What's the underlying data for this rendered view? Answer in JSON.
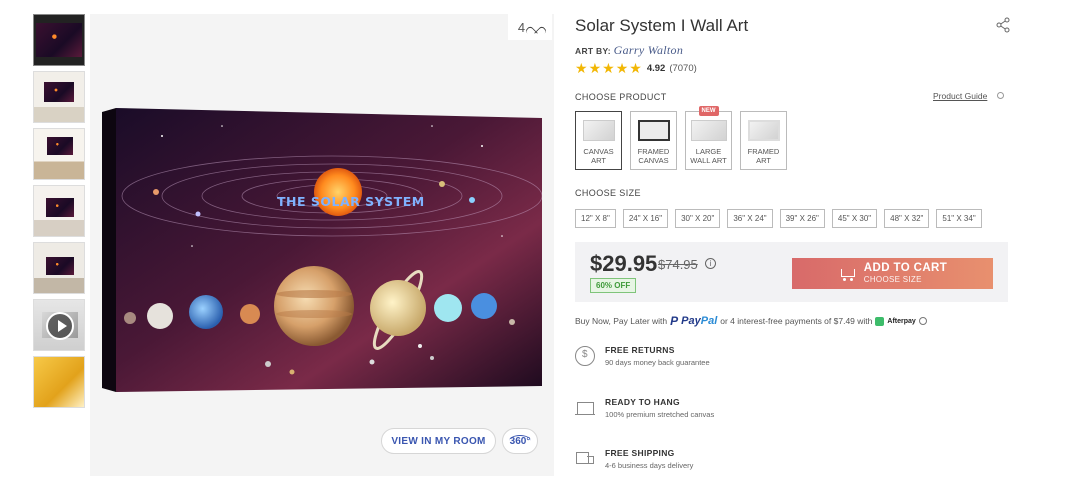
{
  "gallery": {
    "favorite_count": "4",
    "view_in_room_label": "VIEW IN MY ROOM",
    "view_360_label": "360°",
    "art_heading": "THE SOLAR SYSTEM"
  },
  "product": {
    "title": "Solar System I Wall Art",
    "art_by_label": "ART BY:",
    "artist": "Garry Walton",
    "rating": {
      "stars": 4.92,
      "score": "4.92",
      "count": "(7070)"
    },
    "star_color": "#f2b705"
  },
  "choose_product": {
    "label": "CHOOSE PRODUCT",
    "guide_link": "Product Guide",
    "options": [
      {
        "line1": "CANVAS",
        "line2": "ART",
        "selected": true,
        "badge": ""
      },
      {
        "line1": "FRAMED",
        "line2": "CANVAS",
        "selected": false,
        "badge": ""
      },
      {
        "line1": "LARGE",
        "line2": "WALL ART",
        "selected": false,
        "badge": "NEW"
      },
      {
        "line1": "FRAMED",
        "line2": "ART",
        "selected": false,
        "badge": ""
      }
    ]
  },
  "choose_size": {
    "label": "CHOOSE SIZE",
    "sizes": [
      "12\" X 8\"",
      "24\" X 16\"",
      "30\" X 20\"",
      "36\" X 24\"",
      "39\" X 26\"",
      "45\" X 30\"",
      "48\" X 32\"",
      "51\" X 34\""
    ]
  },
  "pricing": {
    "price": "$29.95",
    "old_price": "$74.95",
    "info_glyph": "i",
    "discount": "60% OFF",
    "cart_label": "ADD TO CART",
    "cart_sublabel": "CHOOSE SIZE",
    "cart_gradient": [
      "#d86a6a",
      "#e8906e"
    ]
  },
  "paylater": {
    "prefix": "Buy Now, Pay Later with",
    "paypal_mark": "P",
    "paypal_pay": "Pay",
    "paypal_pal": "Pal",
    "middle": "or 4 interest-free payments of $7.49 with",
    "afterpay": "Afterpay"
  },
  "features": [
    {
      "title": "FREE RETURNS",
      "subtitle": "90 days money back guarantee",
      "icon": "returns-icon"
    },
    {
      "title": "READY TO HANG",
      "subtitle": "100% premium stretched canvas",
      "icon": "canvas-icon"
    },
    {
      "title": "FREE SHIPPING",
      "subtitle": "4-6 business days delivery",
      "icon": "truck-icon"
    }
  ]
}
